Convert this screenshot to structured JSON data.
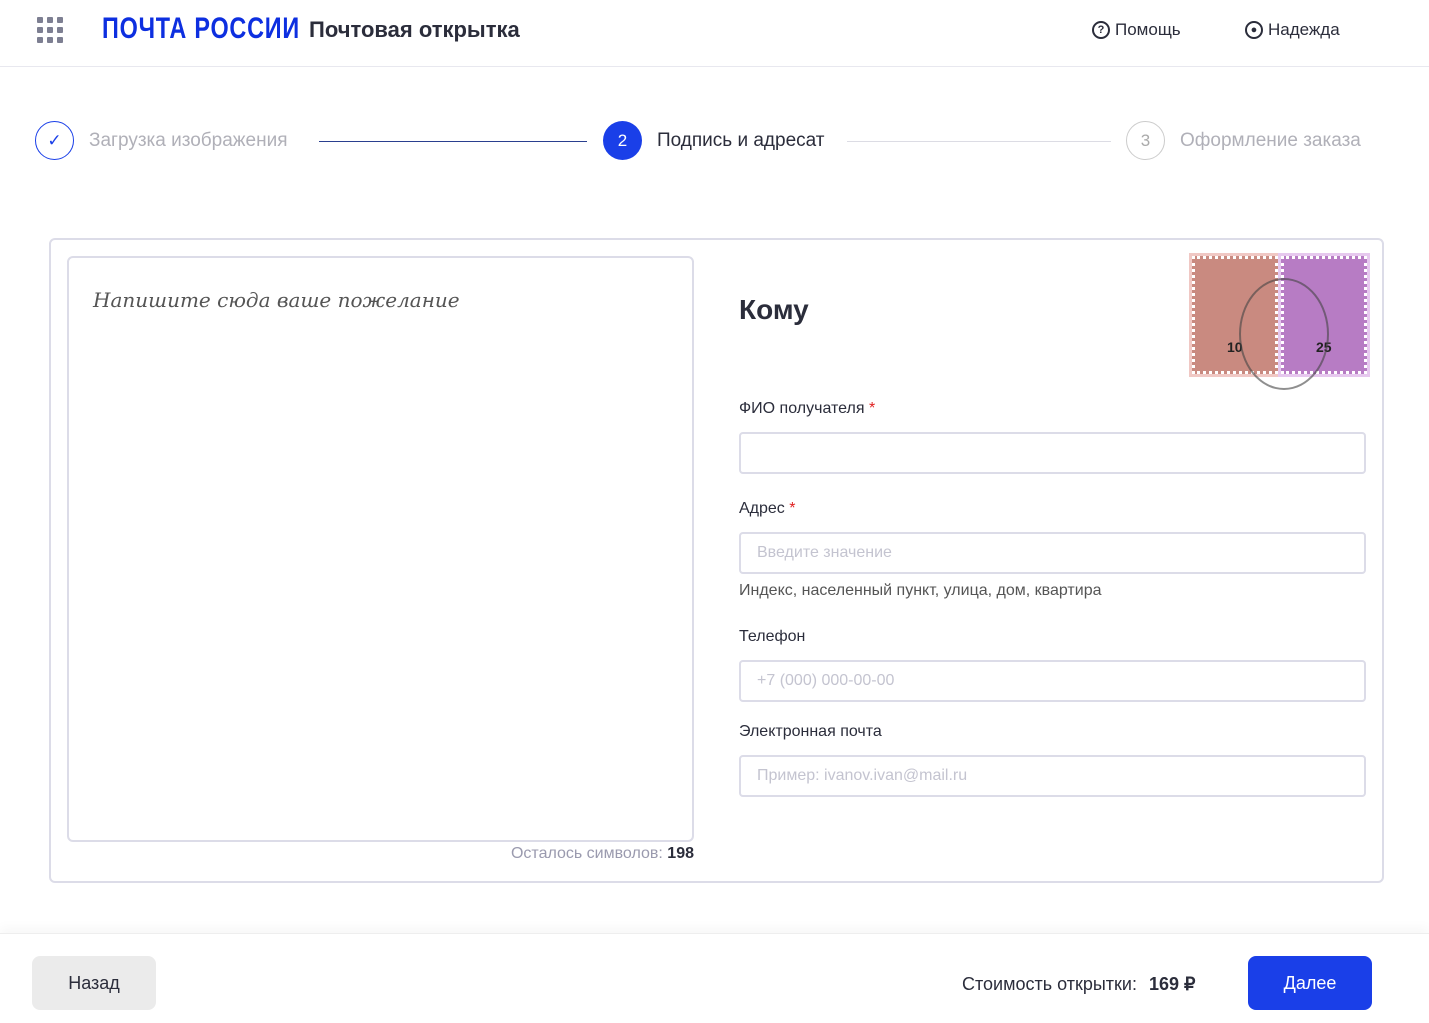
{
  "header": {
    "logo": "ПОЧТА РОССИИ",
    "title": "Почтовая открытка",
    "help": "Помощь",
    "user": "Надежда"
  },
  "steps": [
    {
      "number": "✓",
      "label": "Загрузка изображения"
    },
    {
      "number": "2",
      "label": "Подпись и адресат"
    },
    {
      "number": "3",
      "label": "Оформление заказа"
    }
  ],
  "message": {
    "placeholder": "Напишите сюда ваше пожелание",
    "counter_label": "Осталось символов:",
    "counter_value": "198"
  },
  "recipient": {
    "heading": "Кому",
    "req": "*",
    "name_label": "ФИО получателя",
    "name_value": "",
    "address_label": "Адрес",
    "address_placeholder": "Введите значение",
    "address_hint": "Индекс, населенный пункт, улица, дом, квартира",
    "phone_label": "Телефон",
    "phone_placeholder": "+7 (000) 000-00-00",
    "email_label": "Электронная почта",
    "email_placeholder": "Пример: ivanov.ivan@mail.ru",
    "stamps": [
      "10",
      "25"
    ]
  },
  "footer": {
    "back": "Назад",
    "price_label": "Стоимость открытки:",
    "price": "169 ₽",
    "next": "Далее"
  }
}
